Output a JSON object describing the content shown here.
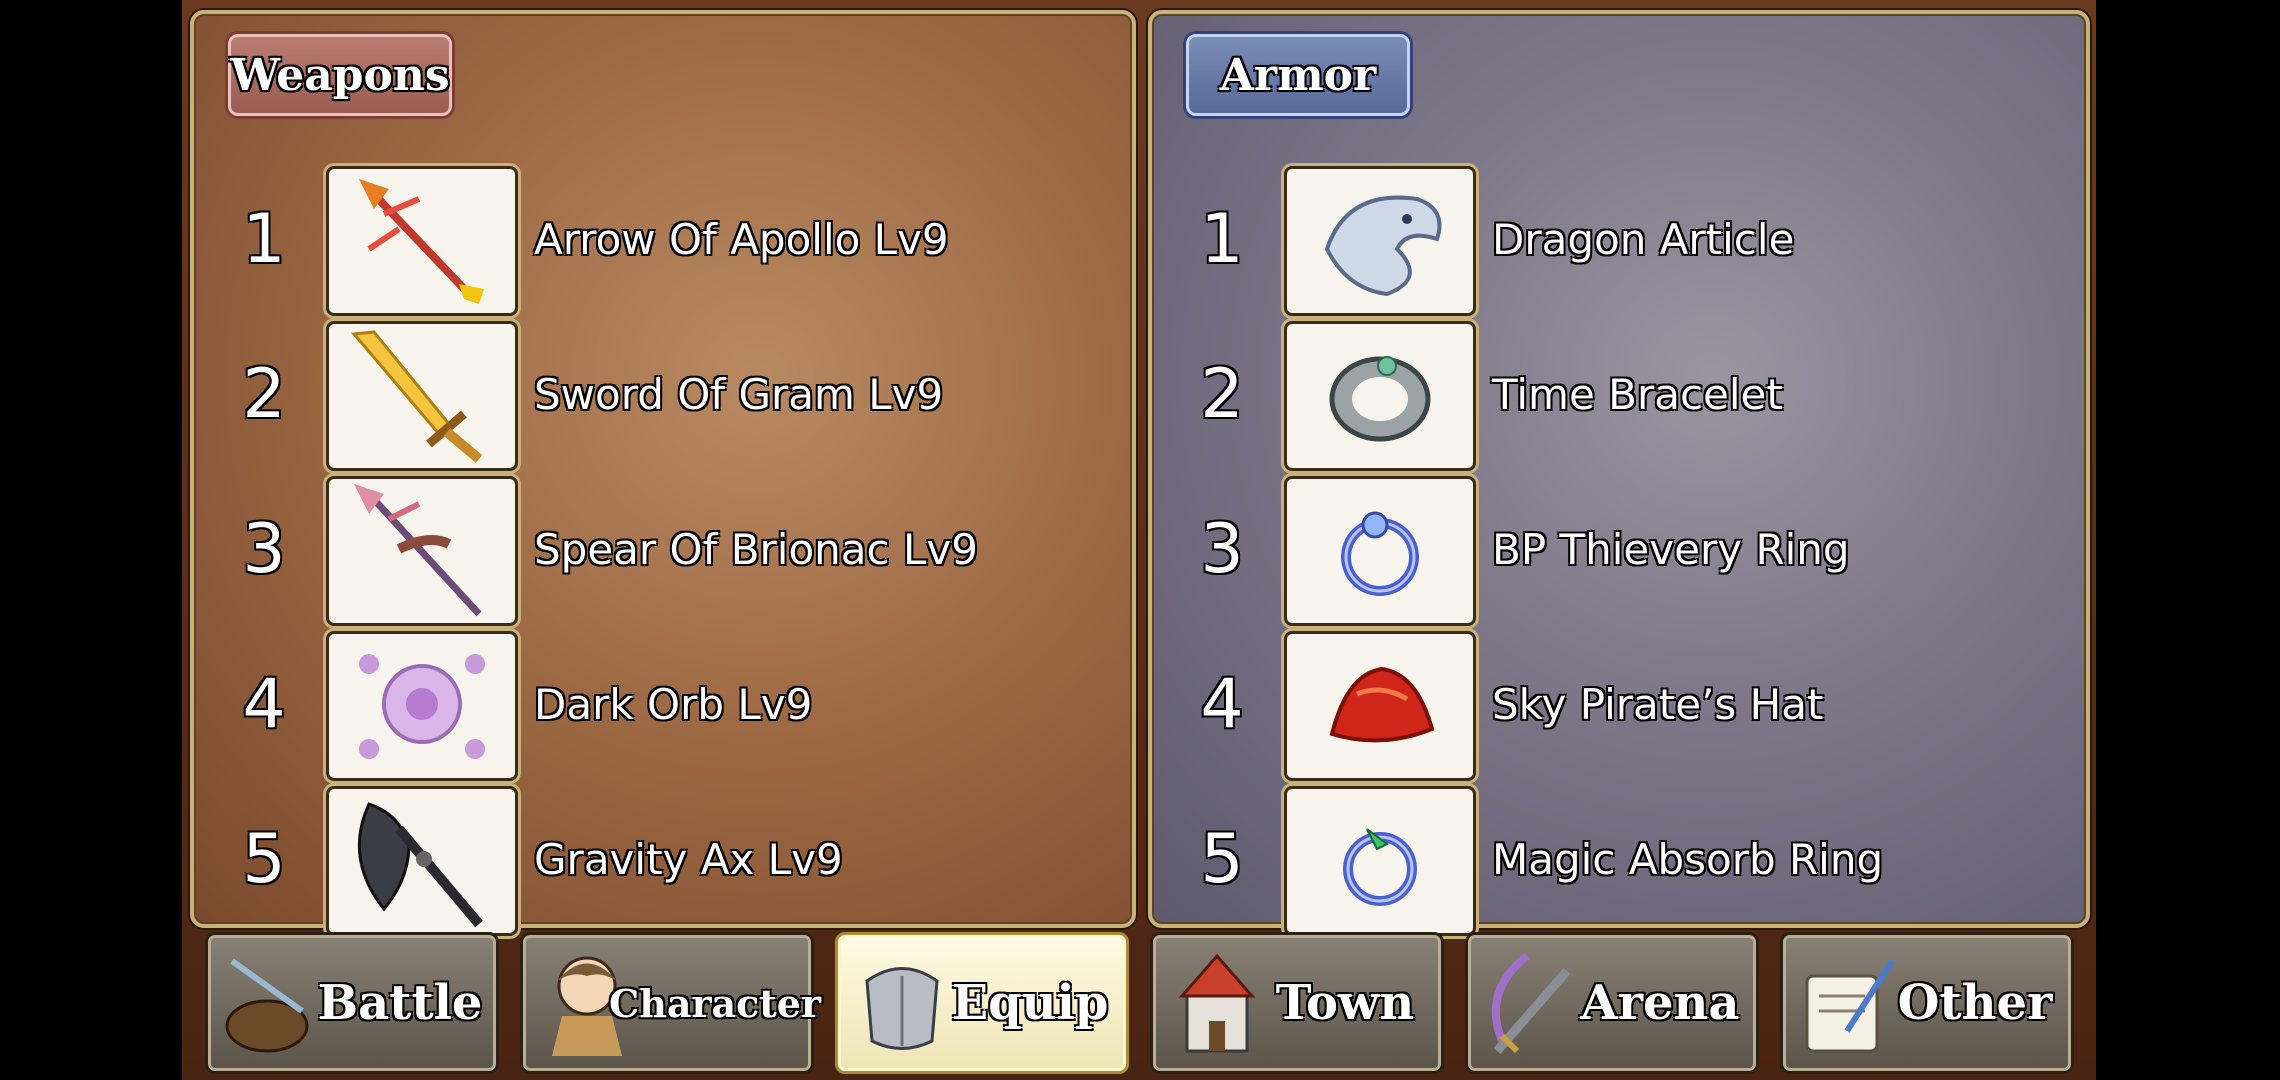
{
  "weapons": {
    "title": "Weapons",
    "items": [
      {
        "num": "1",
        "name": "Arrow Of Apollo Lv9",
        "icon": "arrow-icon"
      },
      {
        "num": "2",
        "name": "Sword Of Gram Lv9",
        "icon": "sword-icon"
      },
      {
        "num": "3",
        "name": "Spear Of Brionac Lv9",
        "icon": "spear-icon"
      },
      {
        "num": "4",
        "name": "Dark Orb Lv9",
        "icon": "orb-icon"
      },
      {
        "num": "5",
        "name": "Gravity Ax Lv9",
        "icon": "axe-icon"
      }
    ]
  },
  "armor": {
    "title": "Armor",
    "items": [
      {
        "num": "1",
        "name": "Dragon Article",
        "icon": "dragon-icon"
      },
      {
        "num": "2",
        "name": "Time Bracelet",
        "icon": "bracelet-icon"
      },
      {
        "num": "3",
        "name": "BP Thievery Ring",
        "icon": "ring-icon"
      },
      {
        "num": "4",
        "name": "Sky Pirate’s Hat",
        "icon": "hat-icon"
      },
      {
        "num": "5",
        "name": "Magic Absorb Ring",
        "icon": "ring-icon"
      }
    ]
  },
  "tabs": [
    {
      "label": "Battle",
      "icon": "battle-icon",
      "active": false
    },
    {
      "label": "Character",
      "icon": "character-icon",
      "active": false
    },
    {
      "label": "Equip",
      "icon": "equip-icon",
      "active": true
    },
    {
      "label": "Town",
      "icon": "town-icon",
      "active": false
    },
    {
      "label": "Arena",
      "icon": "arena-icon",
      "active": false
    },
    {
      "label": "Other",
      "icon": "other-icon",
      "active": false
    }
  ]
}
